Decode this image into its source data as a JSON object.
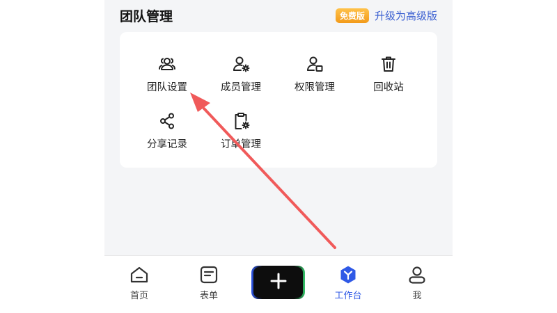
{
  "header": {
    "title": "团队管理",
    "badge": "免费版",
    "upgrade_label": "升级为高级版"
  },
  "menu": [
    {
      "label": "团队设置",
      "icon": "team-icon"
    },
    {
      "label": "成员管理",
      "icon": "member-settings-icon"
    },
    {
      "label": "权限管理",
      "icon": "permission-icon"
    },
    {
      "label": "回收站",
      "icon": "trash-icon"
    },
    {
      "label": "分享记录",
      "icon": "share-icon"
    },
    {
      "label": "订单管理",
      "icon": "order-settings-icon"
    }
  ],
  "tabbar": {
    "tabs": [
      {
        "label": "首页",
        "icon": "home-icon"
      },
      {
        "label": "表单",
        "icon": "form-icon"
      },
      {
        "label": "工作台",
        "icon": "workbench-icon",
        "active": true
      },
      {
        "label": "我",
        "icon": "profile-icon"
      }
    ],
    "center_button_icon": "plus-icon"
  },
  "colors": {
    "accent": "#2f59e6",
    "upgrade_text": "#3a5fd1",
    "badge": "#f29a1a",
    "annotation_arrow": "#f05a5a"
  }
}
